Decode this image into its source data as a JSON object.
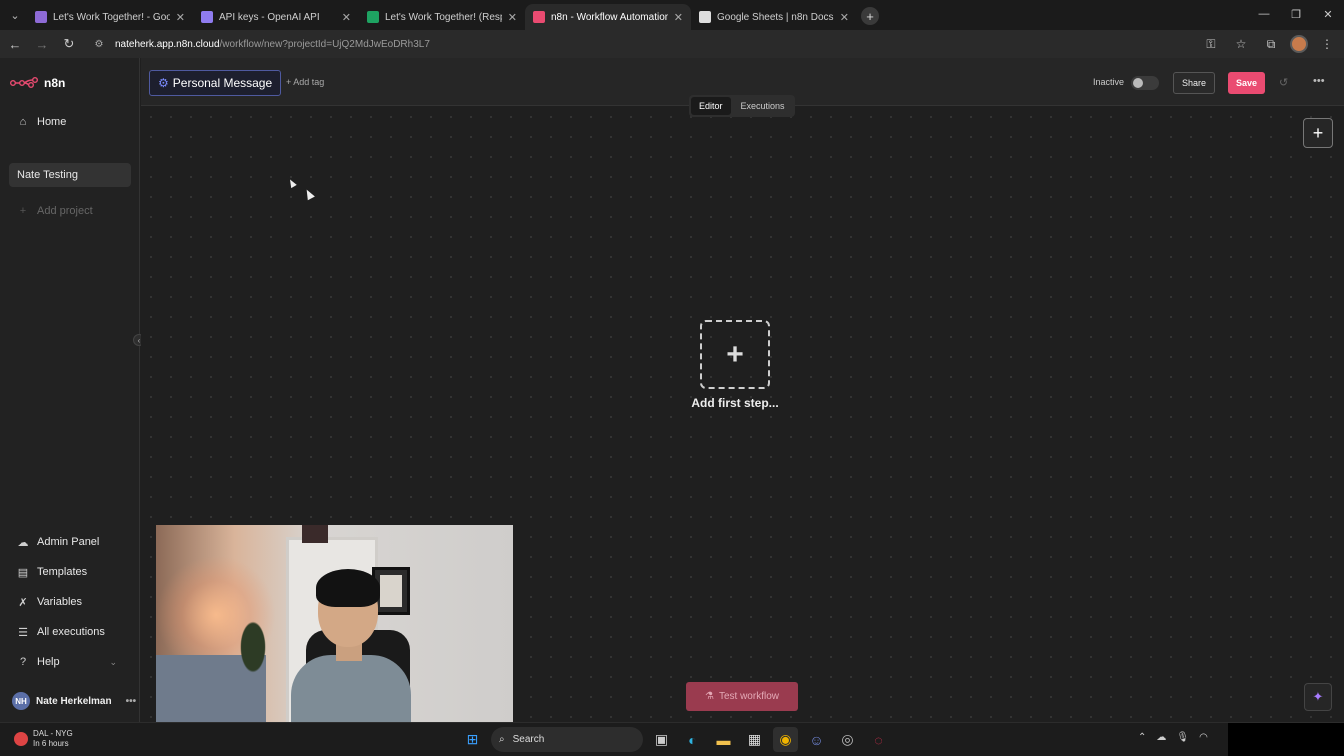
{
  "browser": {
    "tabs": [
      {
        "label": "Let's Work Together! - Google F",
        "color": "#8e6bd6",
        "active": false
      },
      {
        "label": "API keys - OpenAI API",
        "color": "#8f7cf0",
        "active": false
      },
      {
        "label": "Let's Work Together! (Respons",
        "color": "#1ea362",
        "active": false
      },
      {
        "label": "n8n - Workflow Automation",
        "color": "#ea4b71",
        "active": true
      },
      {
        "label": "Google Sheets | n8n Docs",
        "color": "#dddddd",
        "active": false
      }
    ],
    "new_tab": "+",
    "url_host": "nateherk.app.n8n.cloud",
    "url_path": "/workflow/new?projectId=UjQ2MdJwEoDRh3L7"
  },
  "app": {
    "logo_text": "n8n",
    "sidebar": {
      "top_items": [
        {
          "label": "Home",
          "icon": "home-icon",
          "glyph": "⌂"
        }
      ],
      "project": "Nate Testing",
      "add_project": "Add project",
      "bottom_items": [
        {
          "label": "Admin Panel",
          "icon": "cloud-icon",
          "glyph": "☁"
        },
        {
          "label": "Templates",
          "icon": "templates-icon",
          "glyph": "▤"
        },
        {
          "label": "Variables",
          "icon": "variables-icon",
          "glyph": "✗"
        },
        {
          "label": "All executions",
          "icon": "list-icon",
          "glyph": "☰"
        },
        {
          "label": "Help",
          "icon": "help-icon",
          "glyph": "?"
        }
      ],
      "user": {
        "initials": "NH",
        "name": "Nate Herkelman"
      }
    },
    "header": {
      "workflow_name": "Personal Message",
      "add_tag": "+ Add tag",
      "status": "Inactive",
      "share": "Share",
      "save": "Save"
    },
    "modes": [
      "Editor",
      "Executions"
    ],
    "canvas": {
      "add_first_step": "Add first step...",
      "test_workflow": "Test workflow"
    }
  },
  "taskbar": {
    "weather_line1": "DAL - NYG",
    "weather_line2": "In 6 hours",
    "search": "Search"
  }
}
